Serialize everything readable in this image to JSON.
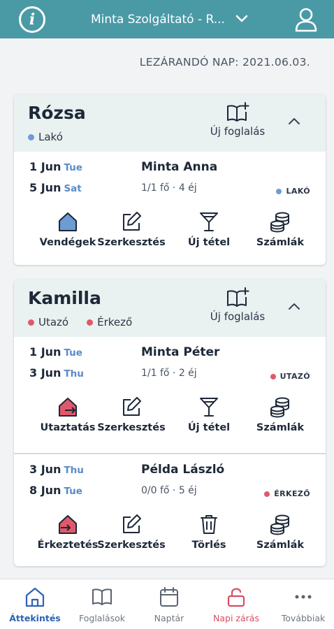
{
  "header": {
    "provider": "Minta Szolgáltató - R...",
    "info_icon": "info-icon",
    "dropdown_icon": "chevron-down-icon",
    "user_icon": "user-icon"
  },
  "closing_day": "LEZÁRANDÓ NAP: 2021.06.03.",
  "rooms": [
    {
      "name": "Rózsa",
      "statuses": [
        {
          "label": "Lakó",
          "color": "#6d9bd4"
        }
      ],
      "new_booking_label": "Új foglalás",
      "bookings": [
        {
          "start_day": "1 Jun",
          "start_dow": "Tue",
          "end_day": "5 Jun",
          "end_dow": "Sat",
          "guest": "Minta Anna",
          "info": "1/1 fő · 4 éj",
          "badge": "LAKÓ",
          "badge_color": "#6d9bd4",
          "actions": [
            {
              "label": "Vendégek",
              "icon": "house-icon"
            },
            {
              "label": "Szerkesztés",
              "icon": "edit-icon"
            },
            {
              "label": "Új tétel",
              "icon": "cocktail-icon"
            },
            {
              "label": "Számlák",
              "icon": "coins-icon"
            }
          ]
        }
      ]
    },
    {
      "name": "Kamilla",
      "statuses": [
        {
          "label": "Utazó",
          "color": "#e0596b"
        },
        {
          "label": "Érkező",
          "color": "#e0596b"
        }
      ],
      "new_booking_label": "Új foglalás",
      "bookings": [
        {
          "start_day": "1 Jun",
          "start_dow": "Tue",
          "end_day": "3 Jun",
          "end_dow": "Thu",
          "guest": "Minta Péter",
          "info": "1/1 fő · 2 éj",
          "badge": "UTAZÓ",
          "badge_color": "#e0596b",
          "actions": [
            {
              "label": "Utaztatás",
              "icon": "checkout-house-icon"
            },
            {
              "label": "Szerkesztés",
              "icon": "edit-icon"
            },
            {
              "label": "Új tétel",
              "icon": "cocktail-icon"
            },
            {
              "label": "Számlák",
              "icon": "coins-icon"
            }
          ]
        },
        {
          "start_day": "3 Jun",
          "start_dow": "Thu",
          "end_day": "8 Jun",
          "end_dow": "Tue",
          "guest": "Példa László",
          "info": "0/0 fő · 5 éj",
          "badge": "ÉRKEZŐ",
          "badge_color": "#e0596b",
          "actions": [
            {
              "label": "Érkeztetés",
              "icon": "checkin-house-icon"
            },
            {
              "label": "Szerkesztés",
              "icon": "edit-icon"
            },
            {
              "label": "Törlés",
              "icon": "trash-icon"
            },
            {
              "label": "Számlák",
              "icon": "coins-icon"
            }
          ]
        }
      ]
    }
  ],
  "nav": [
    {
      "label": "Áttekintés",
      "icon": "home-icon",
      "state": "active"
    },
    {
      "label": "Foglalások",
      "icon": "book-icon",
      "state": "normal"
    },
    {
      "label": "Naptár",
      "icon": "calendar-icon",
      "state": "normal"
    },
    {
      "label": "Napi zárás",
      "icon": "unlock-icon",
      "state": "alert"
    },
    {
      "label": "Továbbiak",
      "icon": "more-icon",
      "state": "normal"
    }
  ],
  "colors": {
    "header_bg": "#4a9aa6",
    "card_head_bg": "#e9f1f1",
    "accent_blue": "#2d63b5",
    "day_blue": "#5a8ac8",
    "alert_red": "#d94d62"
  }
}
